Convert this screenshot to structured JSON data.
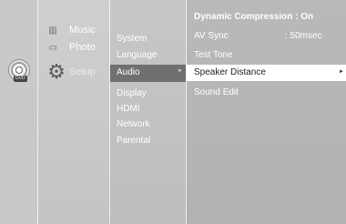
{
  "main_menu": [
    {
      "label": "Music",
      "icon": "music-icon"
    },
    {
      "label": "Photo",
      "icon": "photo-icon"
    },
    {
      "label": "Setup",
      "icon": "gear-icon"
    }
  ],
  "disc_badge": "DVD",
  "setup_menu": [
    "System",
    "Language",
    "Audio",
    "Display",
    "HDMI",
    "Network",
    "Parental"
  ],
  "audio_options": [
    {
      "label": "Dynamic Compression : On",
      "value": ""
    },
    {
      "label": "AV Sync",
      "value": ": 50msec"
    },
    {
      "label": "Test Tone",
      "value": ""
    },
    {
      "label": "Speaker Distance",
      "value": ""
    },
    {
      "label": "Sound Edit",
      "value": ""
    }
  ],
  "arrow": "►"
}
